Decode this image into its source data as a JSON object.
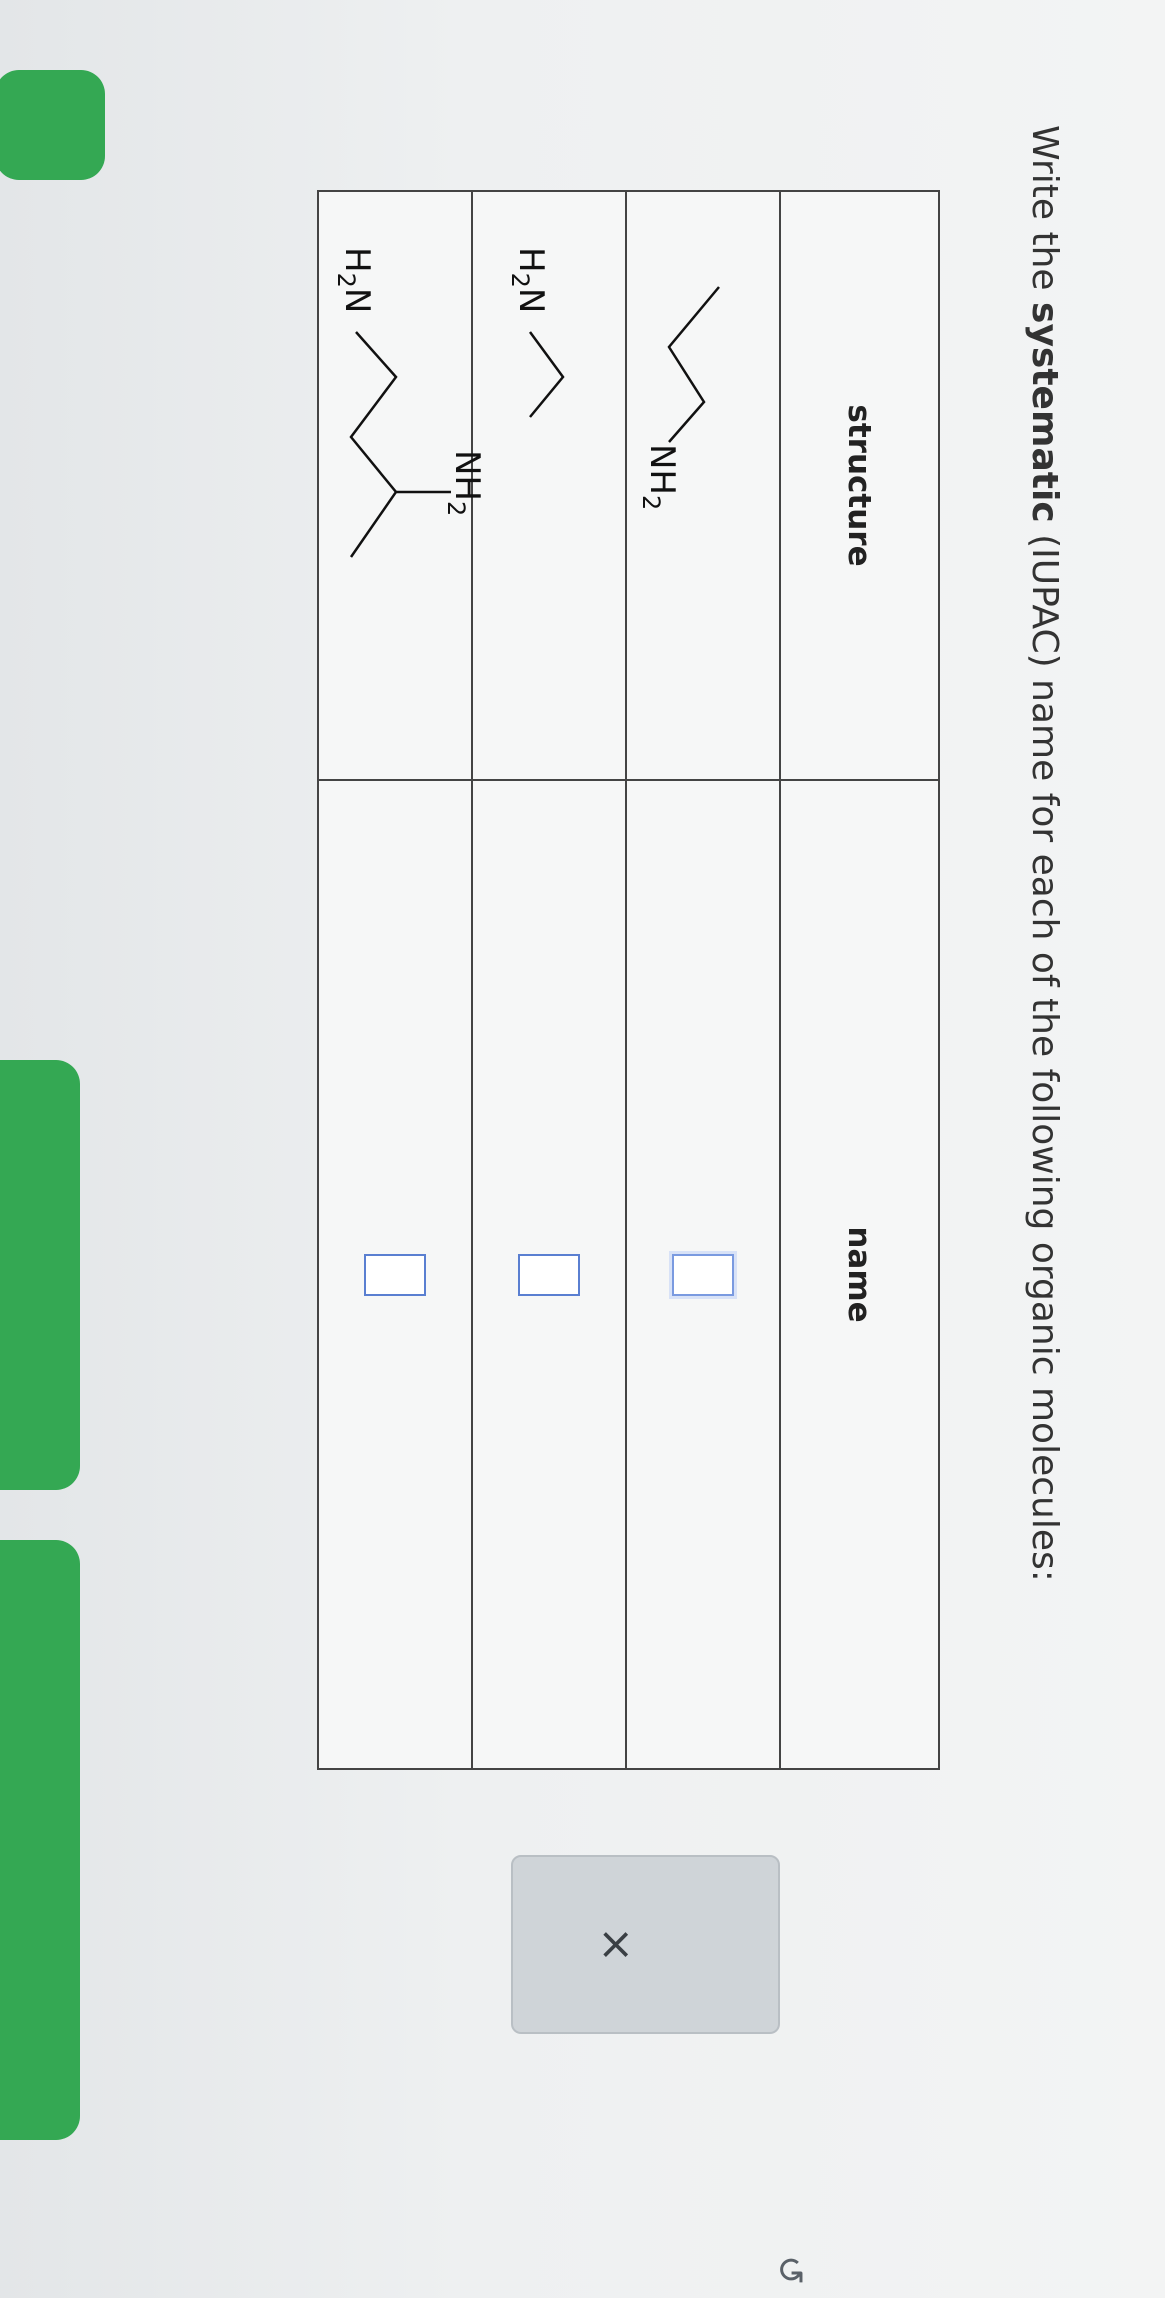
{
  "question": {
    "prefix": "Write the ",
    "bold": "systematic",
    "suffix": " (IUPAC) name for each of the following organic molecules:"
  },
  "table": {
    "headers": [
      "structure",
      "name"
    ],
    "rows": [
      {
        "group": "NH",
        "sub": "2",
        "answer": ""
      },
      {
        "group": "H",
        "group_tail": "N",
        "sub": "2",
        "answer": ""
      },
      {
        "group_left": "H",
        "group_left_tail": "N",
        "sub": "2",
        "group_top": "NH",
        "answer": ""
      }
    ]
  },
  "controls": {
    "clear_label": "×",
    "undo_label": "↺"
  },
  "colors": {
    "accent_green": "#34a853",
    "answer_box_border": "#5a7fd1"
  }
}
